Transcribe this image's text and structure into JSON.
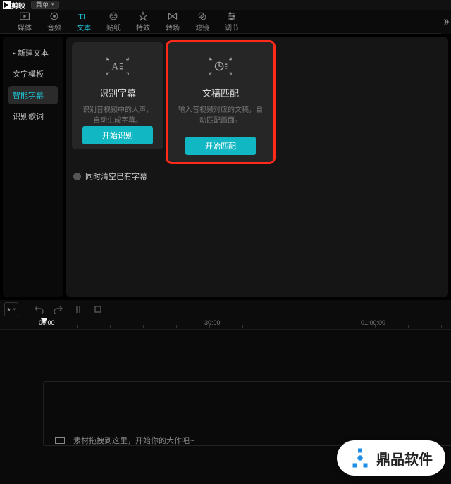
{
  "titlebar": {
    "app_name": "剪映",
    "menu_label": "菜单"
  },
  "tabs": [
    {
      "label": "媒体"
    },
    {
      "label": "音频"
    },
    {
      "label": "文本"
    },
    {
      "label": "贴纸"
    },
    {
      "label": "特效"
    },
    {
      "label": "转场"
    },
    {
      "label": "滤镜"
    },
    {
      "label": "调节"
    }
  ],
  "sidebar": {
    "items": [
      {
        "label": "新建文本",
        "has_caret": true
      },
      {
        "label": "文字模板"
      },
      {
        "label": "智能字幕"
      },
      {
        "label": "识别歌词"
      }
    ]
  },
  "cards": {
    "recognize": {
      "title": "识别字幕",
      "desc": "识别音视频中的人声，自动生成字幕。",
      "button": "开始识别"
    },
    "match": {
      "title": "文稿匹配",
      "desc": "输入音视频对应的文稿，自动匹配画面。",
      "button": "开始匹配"
    }
  },
  "checkbox_label": "同时清空已有字幕",
  "timeline": {
    "t0": "00:00",
    "t1": "30:00",
    "t2": "01:00:00",
    "drop_hint": "素材拖拽到这里，开始你的大作吧~"
  },
  "watermark": {
    "text": "鼎品软件"
  }
}
